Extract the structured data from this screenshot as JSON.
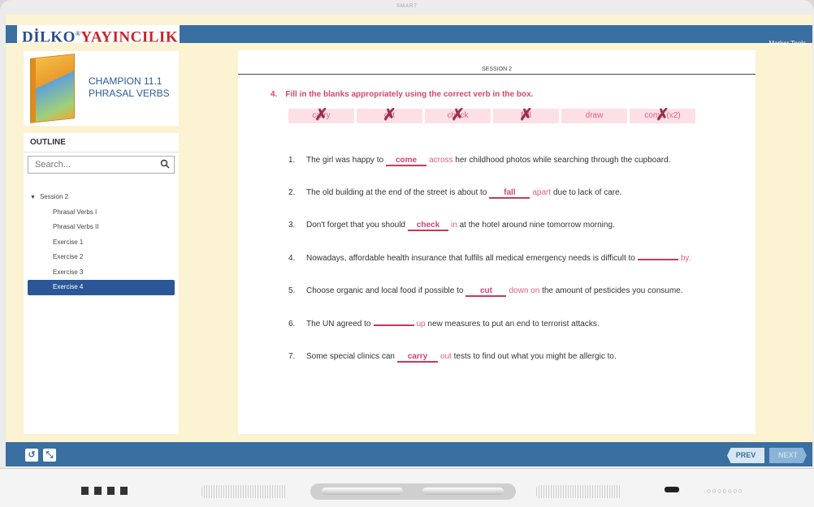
{
  "device": {
    "brand": "SMART"
  },
  "header": {
    "logo_part1": "DİLKO",
    "logo_reg": "®",
    "logo_part2": "YAYINCILIK",
    "marker_tools": "Marker Tools"
  },
  "book": {
    "title_line1": "CHAMPION 11.1",
    "title_line2": "PHRASAL VERBS"
  },
  "outline": {
    "heading": "OUTLINE",
    "search_placeholder": "Search...",
    "session": "Session 2",
    "items": [
      "Phrasal Verbs I",
      "Phrasal Verbs II",
      "Exercise 1",
      "Exercise 2",
      "Exercise 3",
      "Exercise 4"
    ],
    "active_index": 5
  },
  "content": {
    "session_label": "SESSION 2",
    "question_number": "4.",
    "question_text": "Fill in the blanks appropriately using the correct verb in the box.",
    "word_box": [
      {
        "word": "carry",
        "crossed": true
      },
      {
        "word": "cut",
        "crossed": true
      },
      {
        "word": "check",
        "crossed": true
      },
      {
        "word": "fall",
        "crossed": true
      },
      {
        "word": "draw",
        "crossed": false
      },
      {
        "word": "come (x2)",
        "crossed": true
      }
    ],
    "sentences": [
      {
        "num": "1.",
        "before": "The girl was happy to",
        "answer": "come",
        "particle": "across",
        "after": "her childhood photos while  searching through the cupboard."
      },
      {
        "num": "2.",
        "before": "The old building at the end of the street is about to",
        "answer": "fall",
        "particle": "apart",
        "after": "due to lack of care."
      },
      {
        "num": "3.",
        "before": "Don't forget that you should",
        "answer": "check",
        "particle": "in",
        "after": "at the hotel around nine  tomorrow morning."
      },
      {
        "num": "4.",
        "before": "Nowadays, affordable health insurance that fulfils all medical emergency  needs is difficult to",
        "answer": "",
        "particle": "by.",
        "after": ""
      },
      {
        "num": "5.",
        "before": "Choose organic and local food if  possible to",
        "answer": "cut",
        "particle": "down on",
        "after": "the  amount of pesticides you consume."
      },
      {
        "num": "6.",
        "before": "The UN agreed to",
        "answer": "",
        "particle": "up",
        "after": "new measures to put an end to  terrorist attacks."
      },
      {
        "num": "7.",
        "before": "Some special clinics can",
        "answer": "carry",
        "particle": "out",
        "after": "tests to find out what you  might be allergic to."
      }
    ]
  },
  "footer": {
    "prev": "PREV",
    "next": "NEXT",
    "reset_icon": "↺",
    "collapse_icon": "⤡"
  },
  "colors": {
    "blue": "#3a6fa2",
    "pink": "#d9466a",
    "cream": "#fbf3d2"
  }
}
